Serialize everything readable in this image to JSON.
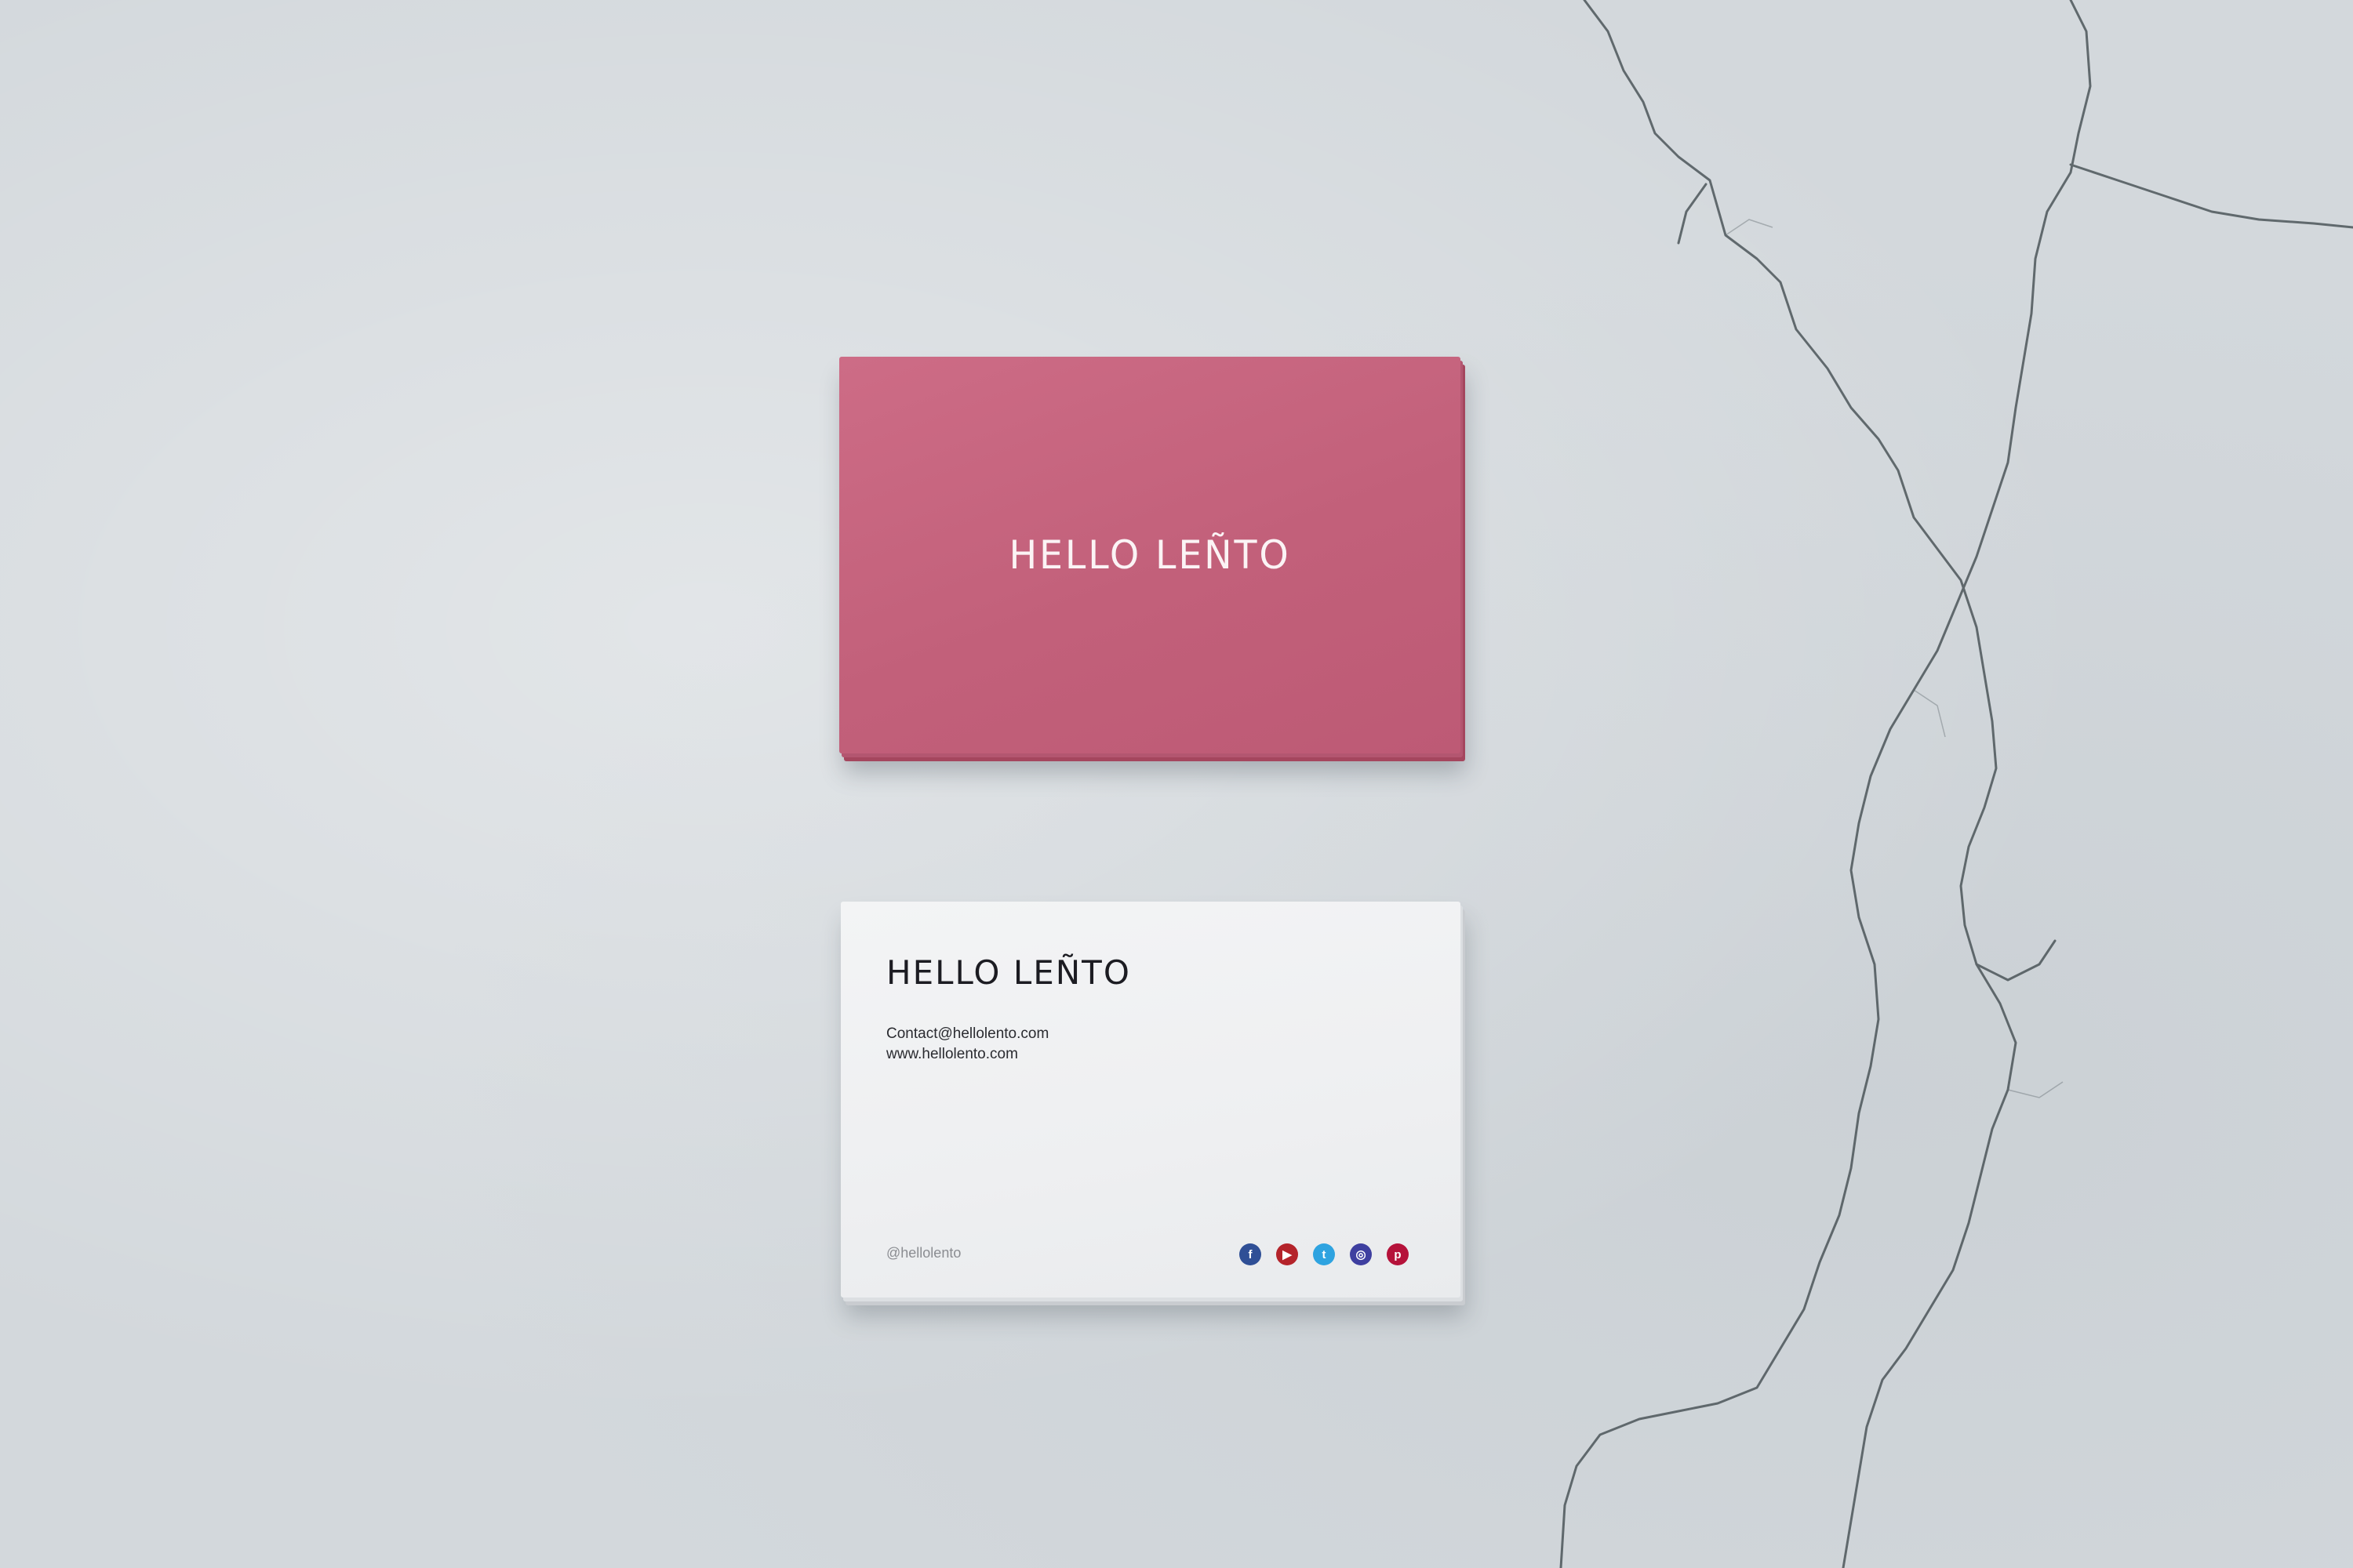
{
  "scene": {
    "wall_color": "#d3d8dc",
    "card_front": {
      "color": "#c2607a",
      "logo_text": "HELLO LEÑTO"
    },
    "card_back": {
      "color": "#eeeff1",
      "logo_text": "HELLO LEÑTO",
      "email": "Contact@hellolento.com",
      "website": "www.hellolento.com",
      "handle": "@hellolento",
      "social_icons": [
        {
          "name": "facebook-icon",
          "color": "#2f4f96",
          "glyph": "f"
        },
        {
          "name": "youtube-icon",
          "color": "#b4232a",
          "glyph": "▶"
        },
        {
          "name": "twitter-icon",
          "color": "#2ea3e0",
          "glyph": "t"
        },
        {
          "name": "instagram-icon",
          "color": "#3e3fa0",
          "glyph": "◎"
        },
        {
          "name": "pinterest-icon",
          "color": "#b5123a",
          "glyph": "p"
        }
      ]
    }
  }
}
